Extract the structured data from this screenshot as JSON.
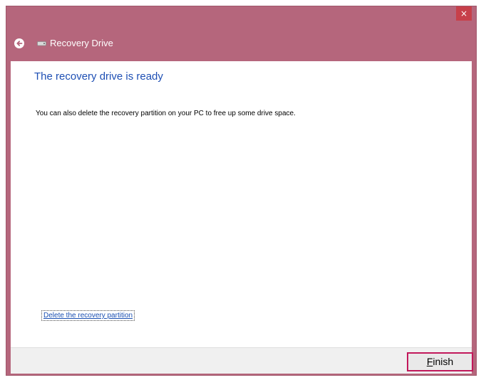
{
  "window": {
    "close_label": "×"
  },
  "nav": {
    "title": "Recovery Drive"
  },
  "main": {
    "heading": "The recovery drive is ready",
    "description": "You can also delete the recovery partition on your PC to free up some drive space.",
    "delete_link": "Delete the recovery partition"
  },
  "footer": {
    "finish_mnemonic": "F",
    "finish_rest": "inish"
  },
  "colors": {
    "frame": "#b5667c",
    "heading": "#1e4fb4",
    "link": "#1a4fb2",
    "finish_border": "#c2185b",
    "close_button": "#c7404a"
  },
  "icons": {
    "back": "back-arrow-icon",
    "drive": "drive-icon",
    "close": "close-icon"
  }
}
